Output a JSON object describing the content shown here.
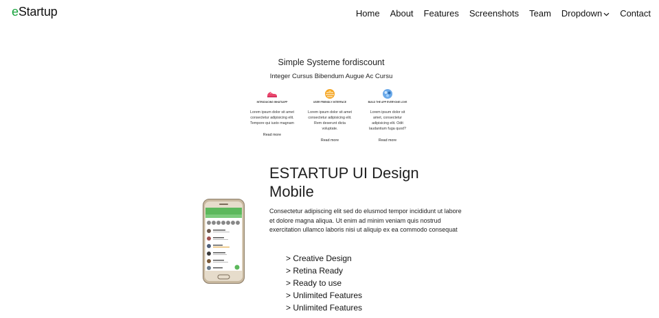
{
  "brand": {
    "prefix": "e",
    "rest": "Startup"
  },
  "nav": {
    "home": "Home",
    "about": "About",
    "features": "Features",
    "screenshots": "Screenshots",
    "team": "Team",
    "dropdown": "Dropdown",
    "contact": "Contact"
  },
  "features_section": {
    "title": "Simple Systeme fordiscount",
    "subtitle": "Integer Cursus Bibendum Augue Ac Cursu",
    "items": [
      {
        "icon": "sneaker-icon",
        "title": "INTRODUCING WHATSAPP",
        "text": "Lorem ipsum dolor sit amet consectetur adipisicing elit. Tempore qui iusto magnam",
        "more": "Read more"
      },
      {
        "icon": "interface-icon",
        "title": "USER FRIENDLY INTERFACE",
        "text": "Lorem ipsum dolor sit amet consectetur adipisicing elit. Rem deserunt dicta voluptate.",
        "more": "Read more"
      },
      {
        "icon": "app-icon",
        "title": "BUILD THE APP EVERYONE LOVE",
        "text": "Lorem ipsum dolor sit amet, consectetur adipisicing elit. Odit laudantium fuga quod?",
        "more": "Read more"
      }
    ]
  },
  "mobile_section": {
    "title": "ESTARTUP UI Design Mobile",
    "description": "Consectetur adipiscing elit sed do elusmod tempor incididunt ut labore et dolore magna aliqua. Ut enim ad minim veniam quis nostrud exercitation ullamco laboris nisi ut aliquip ex ea commodo consequat",
    "list": [
      "> Creative Design",
      "> Retina Ready",
      "> Ready to use",
      "> Unlimited Features",
      "> Unlimited Features"
    ]
  },
  "colors": {
    "brand_accent": "#14a23a",
    "app_green": "#5cb85c"
  }
}
